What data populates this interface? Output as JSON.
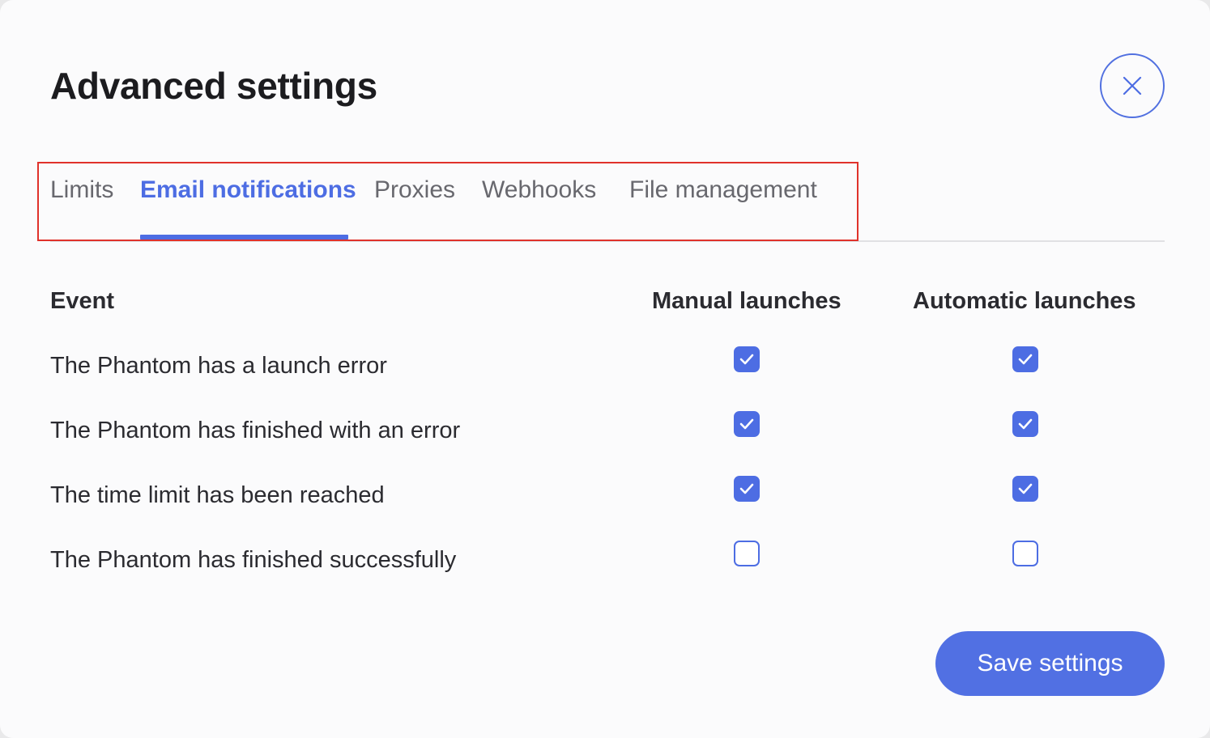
{
  "dialog": {
    "title": "Advanced settings",
    "close_icon": "close-icon"
  },
  "tabs": [
    {
      "label": "Limits",
      "active": false
    },
    {
      "label": "Email notifications",
      "active": true
    },
    {
      "label": "Proxies",
      "active": false
    },
    {
      "label": "Webhooks",
      "active": false
    },
    {
      "label": "File management",
      "active": false
    }
  ],
  "table": {
    "headers": {
      "event": "Event",
      "manual": "Manual launches",
      "automatic": "Automatic launches"
    },
    "rows": [
      {
        "label": "The Phantom has a launch error",
        "manual": true,
        "automatic": true
      },
      {
        "label": "The Phantom has finished with an error",
        "manual": true,
        "automatic": true
      },
      {
        "label": "The time limit has been reached",
        "manual": true,
        "automatic": true
      },
      {
        "label": "The Phantom has finished successfully",
        "manual": false,
        "automatic": false
      }
    ]
  },
  "footer": {
    "save_label": "Save settings"
  },
  "colors": {
    "accent": "#4d6de3",
    "highlight_border": "#e0322b",
    "text": "#2b2b30",
    "muted_text": "#68686e"
  }
}
